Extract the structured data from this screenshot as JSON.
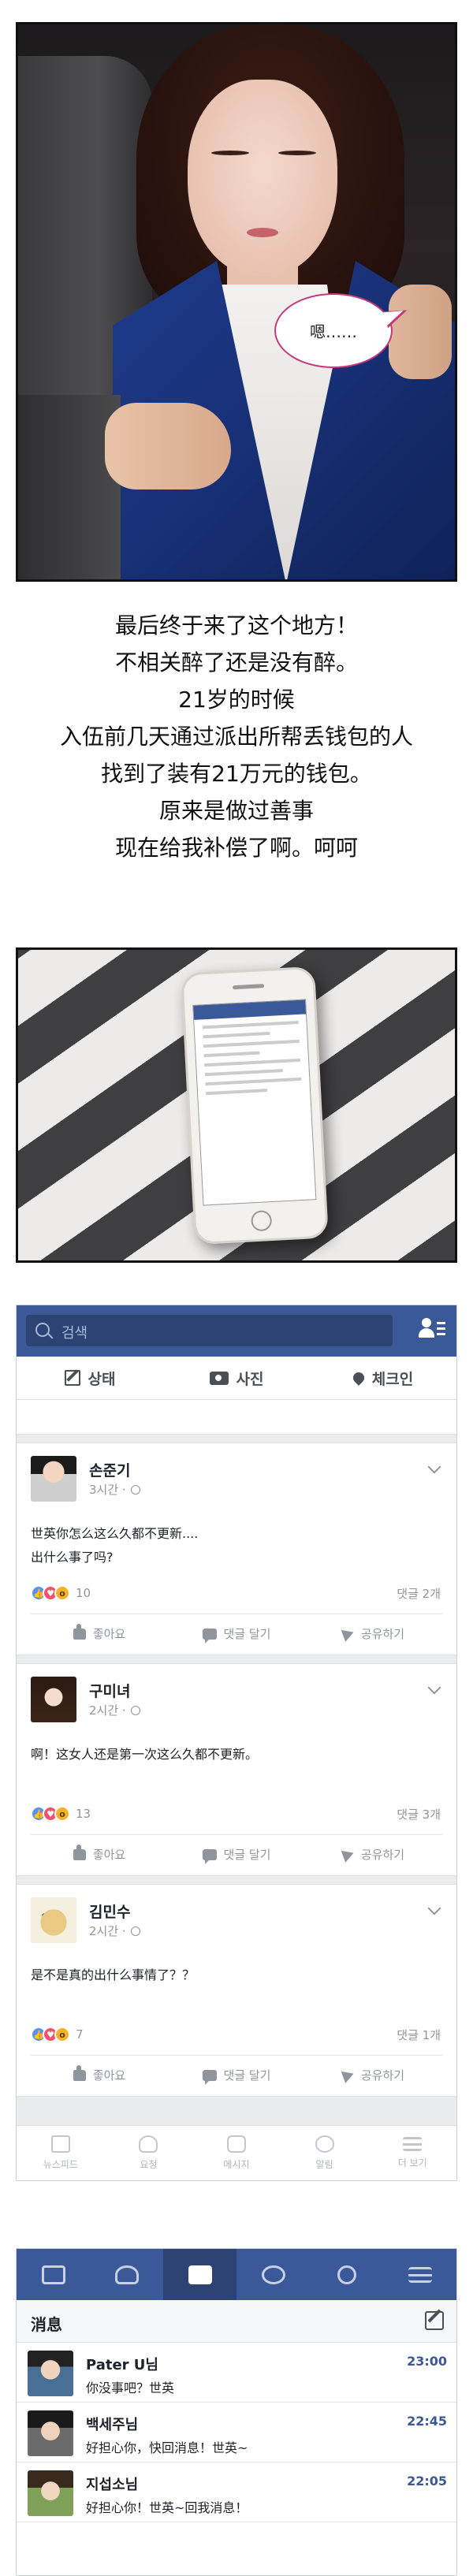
{
  "photo1": {
    "bubble_text": "嗯……"
  },
  "story": {
    "lines": [
      "最后终于来了这个地方！",
      "不相关醉了还是没有醉。",
      "21岁的时候",
      "入伍前几天通过派出所帮丢钱包的人",
      "找到了装有21万元的钱包。",
      "原来是做过善事",
      "现在给我补偿了啊。呵呵"
    ]
  },
  "feed": {
    "search_placeholder": "검색",
    "actions": [
      {
        "label": "상태",
        "icon": "edit-icon"
      },
      {
        "label": "사진",
        "icon": "camera-icon"
      },
      {
        "label": "체크인",
        "icon": "location-pin-icon"
      }
    ],
    "posts": [
      {
        "name": "손준기",
        "time": "3시간",
        "text_lines": [
          "世英你怎么这么久都不更新....",
          "出什么事了吗?"
        ],
        "reactions": [
          "like",
          "love",
          "wow"
        ],
        "reaction_count": "10",
        "comments": "댓글 2개"
      },
      {
        "name": "구미녀",
        "time": "2시간",
        "text_lines": [
          "啊！这女人还是第一次这么久都不更新。"
        ],
        "reactions": [
          "like",
          "love",
          "wow"
        ],
        "reaction_count": "13",
        "comments": "댓글 3개"
      },
      {
        "name": "김민수",
        "time": "2시간",
        "text_lines": [
          "是不是真的出什么事情了？？"
        ],
        "reactions": [
          "like",
          "love",
          "wow"
        ],
        "reaction_count": "7",
        "comments": "댓글 1개"
      }
    ],
    "post_buttons": {
      "like": "좋아요",
      "comment": "댓글 달기",
      "share": "공유하기"
    },
    "bottom_nav": [
      "뉴스피드",
      "요청",
      "메시지",
      "알림",
      "더 보기"
    ]
  },
  "messages": {
    "title": "消息",
    "top_tabs": [
      "news-feed-icon",
      "friends-icon",
      "messages-icon",
      "globe-icon",
      "search-icon",
      "menu-icon"
    ],
    "active_tab": 2,
    "items": [
      {
        "name": "Pater U님",
        "text": "你没事吧？世英",
        "time": "23:00"
      },
      {
        "name": "백세주님",
        "text": "好担心你，快回消息！世英~",
        "time": "22:45"
      },
      {
        "name": "지섭소님",
        "text": "好担心你！世英~回我消息！",
        "time": "22:05"
      }
    ]
  },
  "colors": {
    "facebook_blue": "#3b5998",
    "facebook_dark_blue": "#2d4373",
    "bubble_border": "#c33a7a"
  }
}
